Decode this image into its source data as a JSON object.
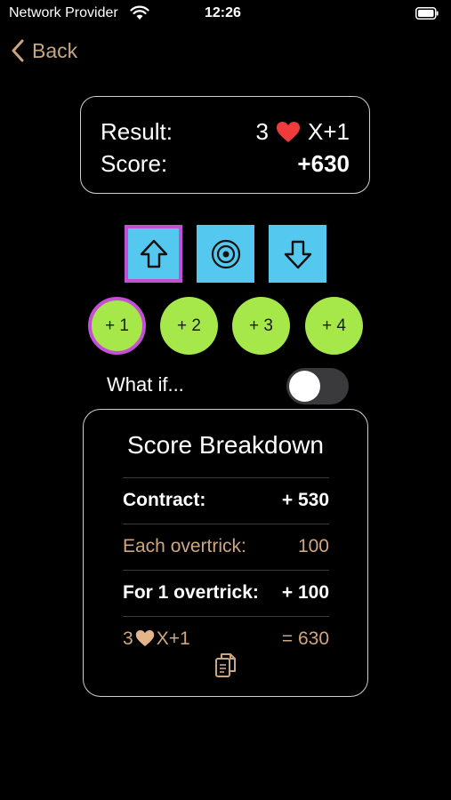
{
  "status": {
    "carrier": "Network Provider",
    "time": "12:26"
  },
  "nav": {
    "back_label": "Back"
  },
  "result": {
    "label": "Result:",
    "tricks": "3",
    "suit_icon": "heart-icon",
    "modifier": "X+1",
    "score_label": "Score:",
    "score_value": "+630"
  },
  "controls": {
    "arrows": [
      {
        "icon": "arrow-up-icon",
        "selected": true
      },
      {
        "icon": "target-icon",
        "selected": false
      },
      {
        "icon": "arrow-down-icon",
        "selected": false
      }
    ],
    "overtricks": [
      {
        "label": "+ 1",
        "selected": true
      },
      {
        "label": "+ 2",
        "selected": false
      },
      {
        "label": "+ 3",
        "selected": false
      },
      {
        "label": "+ 4",
        "selected": false
      }
    ],
    "whatif_label": "What if...",
    "whatif_on": false
  },
  "breakdown": {
    "title": "Score Breakdown",
    "contract_label": "Contract:",
    "contract_value": "+ 530",
    "each_label": "Each overtrick:",
    "each_value": "100",
    "for_label": "For 1 overtrick:",
    "for_value": "+ 100",
    "total_tricks": "3",
    "total_modifier": "X+1",
    "total_value": "= 630"
  },
  "colors": {
    "accent": "#c8a780",
    "button_blue": "#55c8f0",
    "button_green": "#a6e84a",
    "selection": "#c44fd6",
    "heart": "#ef3b3b"
  }
}
